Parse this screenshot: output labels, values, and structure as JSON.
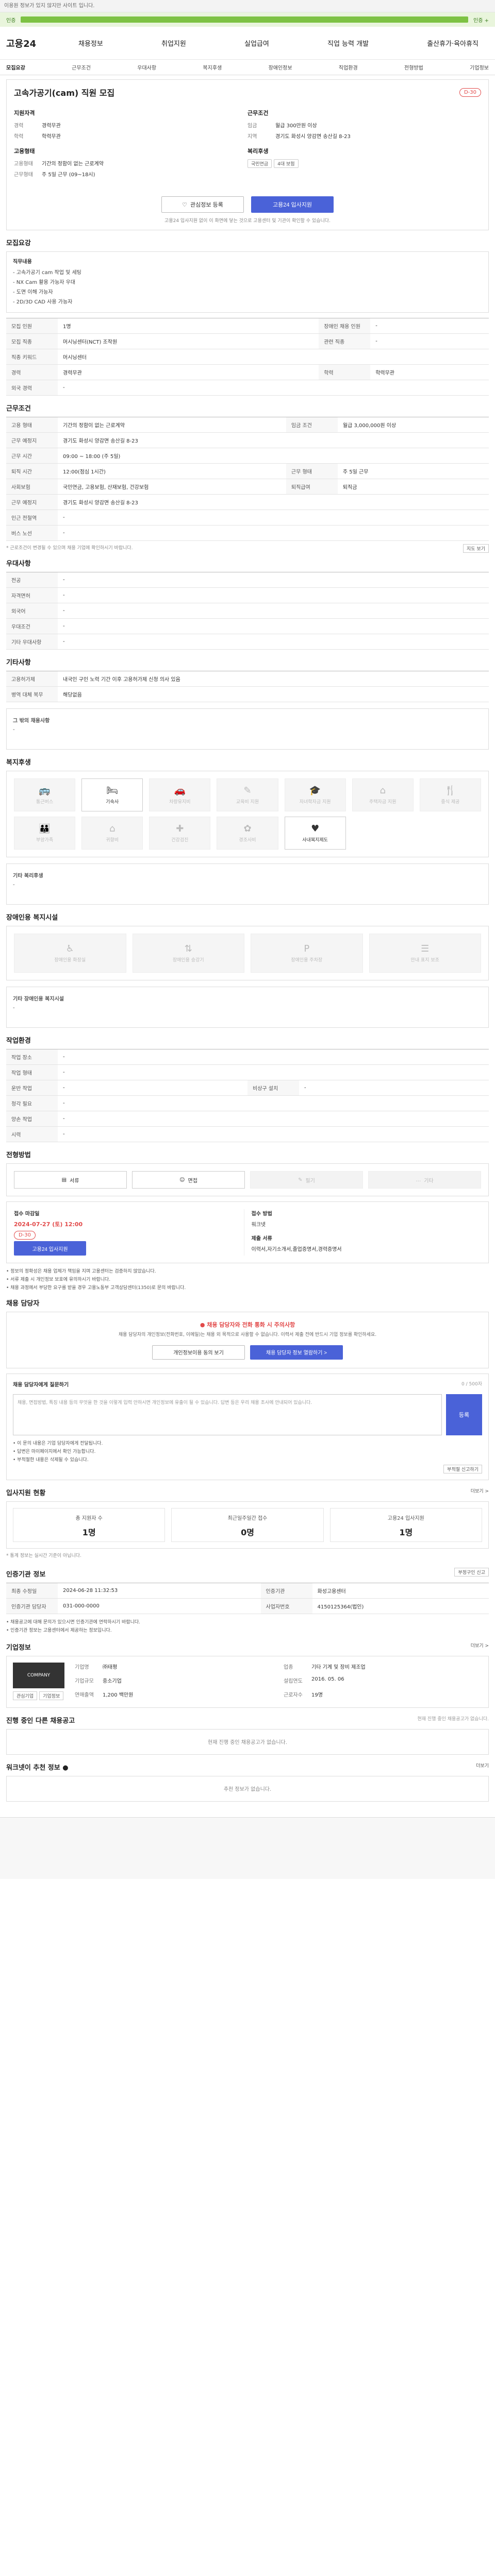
{
  "notice": "이용원 정보가 있지 않지만 사이트 입니다.",
  "progress": {
    "label": "인증",
    "right": "인증 +"
  },
  "logo": "고용24",
  "gnb": [
    "채용정보",
    "취업지원",
    "실업급여",
    "직업 능력 개발",
    "출산휴가·육아휴직"
  ],
  "subnav": [
    "모집요강",
    "근무조건",
    "우대사항",
    "복지후생",
    "장애인정보",
    "직업환경",
    "전형방법",
    "기업정보"
  ],
  "job": {
    "title": "고속가공기(cam) 직원 모집",
    "dday": "D-30",
    "left_head": "지원자격",
    "right_head": "근무조건",
    "left": [
      {
        "k": "경력",
        "v": "경력무관"
      },
      {
        "k": "학력",
        "v": "학력무관"
      }
    ],
    "right": [
      {
        "k": "임금",
        "v": "월급 300만원 이상"
      },
      {
        "k": "지역",
        "v": "경기도 화성시 양감면 송산길 8-23"
      }
    ],
    "left_head2": "고용형태",
    "left2": [
      {
        "k": "고용형태",
        "v": "기간의 정함이 없는 근로계약"
      },
      {
        "k": "근무형태",
        "v": "주 5일 근무 (09~18시)"
      }
    ],
    "right_head2": "복리후생",
    "chips": [
      "국민연금",
      "4대 보험"
    ],
    "btn_save": "관심정보 등록",
    "btn_apply": "고용24 입사지원",
    "note": "고용24 입사지원 없이 이 화면에 닿는 것으로 고용센터 및 기관이 확인할 수 있습니다."
  },
  "recruit": {
    "title": "모집요강",
    "box_title": "직무내용",
    "duties": [
      "- 고속가공기 cam 작업 및 세팅",
      "- NX Cam 활용 가능자 우대",
      "- 도면 이해 가능자",
      "- 2D/3D CAD 사용 가능자"
    ],
    "rows": [
      [
        "모집 인원",
        "1명",
        "장애인 채용 인원",
        "-"
      ],
      [
        "모집 직종",
        "머시닝센터(NCT) 조작원",
        "관련 직종",
        "-"
      ],
      [
        "직종 키워드",
        "머시닝센터",
        "",
        ""
      ],
      [
        "경력",
        "경력무관",
        "학력",
        "학력무관"
      ],
      [
        "외국 경력",
        "-",
        "",
        ""
      ]
    ]
  },
  "condition": {
    "title": "근무조건",
    "rows": [
      [
        "고용 형태",
        "기간의 정함이 없는 근로계약",
        "임금 조건",
        "월급 3,000,000원 이상"
      ],
      [
        "근무 예정지",
        "경기도 화성시 양감면 송산길 8-23",
        "",
        ""
      ],
      [
        "근무 시간",
        "09:00 ~ 18:00 (주 5일)",
        "",
        ""
      ],
      [
        "퇴직 시간",
        "12:00(점심 1시간)",
        "근무 형태",
        "주 5일 근무"
      ],
      [
        "사회보험",
        "국민연금, 고용보험, 산재보험, 건강보험",
        "퇴직급여",
        "퇴직금"
      ],
      [
        "근무 예정지",
        "경기도 화성시 양감면 송산길 8-23",
        "",
        ""
      ],
      [
        "인근 전철역",
        "-",
        "",
        ""
      ],
      [
        "버스 노선",
        "-",
        "",
        ""
      ]
    ],
    "note": "* 근로조건이 변경될 수 있으며 채용 기업에 확인하시기 바랍니다.",
    "map_btn": "지도 보기"
  },
  "pref": {
    "title": "우대사항",
    "rows": [
      [
        "전공",
        "-"
      ],
      [
        "자격면허",
        "-"
      ],
      [
        "외국어",
        "-"
      ],
      [
        "우대조건",
        "-"
      ],
      [
        "기타 우대사항",
        "-"
      ]
    ]
  },
  "other": {
    "title": "기타사항",
    "rows": [
      [
        "고용허가제",
        "내국인 구인 노력 기간 이후 고용허가제 신청 의사 있음"
      ],
      [
        "병역 대체 복무",
        "해당없음"
      ]
    ],
    "box_title": "그 밖의 채용사항",
    "box_text": "-"
  },
  "welfare": {
    "title": "복지후생",
    "items": [
      {
        "label": "통근버스",
        "on": false,
        "icon": "bus-icon",
        "glyph": "🚌"
      },
      {
        "label": "기숙사",
        "on": true,
        "icon": "dorm-icon",
        "glyph": "🛏"
      },
      {
        "label": "차량유지비",
        "on": false,
        "icon": "car-icon",
        "glyph": "🚗"
      },
      {
        "label": "교육비 지원",
        "on": false,
        "icon": "education-icon",
        "glyph": "✎"
      },
      {
        "label": "자녀학자금 지원",
        "on": false,
        "icon": "school-icon",
        "glyph": "🎓"
      },
      {
        "label": "주택자금 지원",
        "on": false,
        "icon": "house-icon",
        "glyph": "⌂"
      },
      {
        "label": "중식 제공",
        "on": false,
        "icon": "meal-icon",
        "glyph": "🍴"
      },
      {
        "label": "부양가족",
        "on": false,
        "icon": "family-icon",
        "glyph": "👪"
      },
      {
        "label": "귀향비",
        "on": false,
        "icon": "home-icon",
        "glyph": "⌂"
      },
      {
        "label": "건강검진",
        "on": false,
        "icon": "health-icon",
        "glyph": "✚"
      },
      {
        "label": "경조사비",
        "on": false,
        "icon": "event-icon",
        "glyph": "✿"
      },
      {
        "label": "사내복지제도",
        "on": true,
        "icon": "welfare-icon",
        "glyph": "♥"
      }
    ],
    "box_title": "기타 복리후생",
    "box_text": "-"
  },
  "disability": {
    "title": "장애인용 복지시설",
    "items": [
      {
        "label": "장애인용 화장실",
        "icon": "toilet-icon",
        "glyph": "♿"
      },
      {
        "label": "장애인용 승강기",
        "icon": "elevator-icon",
        "glyph": "⇅"
      },
      {
        "label": "장애인용 주차장",
        "icon": "parking-icon",
        "glyph": "P"
      },
      {
        "label": "안내 표지 보조",
        "icon": "sign-icon",
        "glyph": "☰"
      }
    ],
    "box_title": "기타 장애인용 복지시설",
    "box_text": "-"
  },
  "env": {
    "title": "작업환경",
    "rows": [
      [
        "작업 장소",
        "-",
        "",
        ""
      ],
      [
        "작업 형태",
        "-",
        "",
        ""
      ],
      [
        "운반 작업",
        "-",
        "비상구 설치",
        "-"
      ],
      [
        "청각 필요",
        "-",
        "",
        ""
      ],
      [
        "양손 작업",
        "-",
        "",
        ""
      ],
      [
        "시력",
        "-",
        "",
        ""
      ]
    ]
  },
  "selection": {
    "title": "전형방법",
    "tabs": [
      {
        "label": "서류",
        "on": true,
        "icon": "document-icon",
        "glyph": "▤"
      },
      {
        "label": "면접",
        "on": true,
        "icon": "interview-icon",
        "glyph": "☺"
      },
      {
        "label": "필기",
        "on": false,
        "icon": "exam-icon",
        "glyph": "✎"
      },
      {
        "label": "기타",
        "on": false,
        "icon": "etc-icon",
        "glyph": "…"
      }
    ],
    "deadline_head": "접수 마감일",
    "deadline": "2024-07-27 (토) 12:00",
    "deadline_badge": "D-30",
    "apply_btn": "고용24 입사지원",
    "method_head": "접수 방법",
    "method": "워크넷",
    "docs_head": "제출 서류",
    "docs": "이력서,자기소개서,졸업증명서,경력증명서",
    "notes": [
      "• 정보의 정확성은 채용 업체가 책임을 지며 고용센터는 검증하지 않았습니다.",
      "• 서류 제출 시 개인정보 보호에 유의하시기 바랍니다.",
      "• 채용 과정에서 부당한 요구를 받을 경우 고용노동부 고객상담센터(1350)로 문의 바랍니다."
    ]
  },
  "contact": {
    "title": "채용 담당자",
    "warn_title": "● 채용 담당자와 전화 통화 시 주의사항",
    "warn_text": "채용 담당자의 개인정보(전화번호, 이메일)는 채용 외 목적으로 사용할 수 없습니다. 이력서 제출 전에 반드시 기업 정보를 확인하세요.",
    "btn1": "개인정보이용 동의 보기",
    "btn2": "채용 담당자 정보 열람하기 >",
    "ask_title": "채용 담당자에게 질문하기",
    "ask_count": "0 / 500자",
    "ask_placeholder": "채용, 면접방법, 특징 내용 등의 무엇을 한 것을 이렇게 입력 안하시면 개인정보에 유출이 될 수 있습니다. 답변 등은 우리 채용 조사에 안내되어 있습니다.",
    "ask_btn": "등록",
    "notes": [
      "• 이 문의 내용은 기업 담당자에게 전달됩니다.",
      "• 답변은 마이페이지에서 확인 가능합니다.",
      "• 부적절한 내용은 삭제될 수 있습니다."
    ],
    "bad_btn": "부적절 신고하기"
  },
  "stats": {
    "title": "입사지원 현황",
    "more": "더보기 >",
    "items": [
      {
        "label": "총 지원자 수",
        "value": "1명"
      },
      {
        "label": "최근일주일간 접수",
        "value": "0명"
      },
      {
        "label": "고용24 입사지원",
        "value": "1명"
      }
    ],
    "note": "* 통계 정보는 실시간 기준이 아닙니다."
  },
  "registry": {
    "title": "인증기관 정보",
    "report_btn": "부정구인 신고",
    "rows": [
      [
        "최종 수정일",
        "2024-06-28 11:32:53",
        "인증기관",
        "화성고용센터"
      ],
      [
        "인증기관 담당자",
        "031-000-0000",
        "사업자번호",
        "4150125364(법인)"
      ]
    ],
    "map_btn": "지도 보기",
    "notes": [
      "• 채용공고에 대해 문의가 있으시면 인증기관에 연락하시기 바랍니다.",
      "• 인증기관 정보는 고용센터에서 제공하는 정보입니다."
    ]
  },
  "company": {
    "title": "기업정보",
    "more": "더보기 >",
    "logo": "COMPANY",
    "btn_a": "관심기업",
    "btn_b": "기업정보",
    "fields": [
      [
        "기업명",
        "㈜태평"
      ],
      [
        "업종",
        "기타 기계 및 장비 제조업"
      ],
      [
        "기업규모",
        "중소기업"
      ],
      [
        "설립연도",
        "2016. 05. 06"
      ],
      [
        "연매출액",
        "1,200 백만원"
      ],
      [
        "근로자수",
        "19명"
      ]
    ]
  },
  "similar": {
    "title": "진행 중인 다른 채용공고",
    "sub": "현재 진행 중인 채용공고가 없습니다.",
    "empty": "현재 진행 중인 채용공고가 없습니다."
  },
  "recommend": {
    "title": "워크넷이 추천 정보 ●",
    "more": "더보기",
    "empty": "추천 정보가 없습니다."
  }
}
